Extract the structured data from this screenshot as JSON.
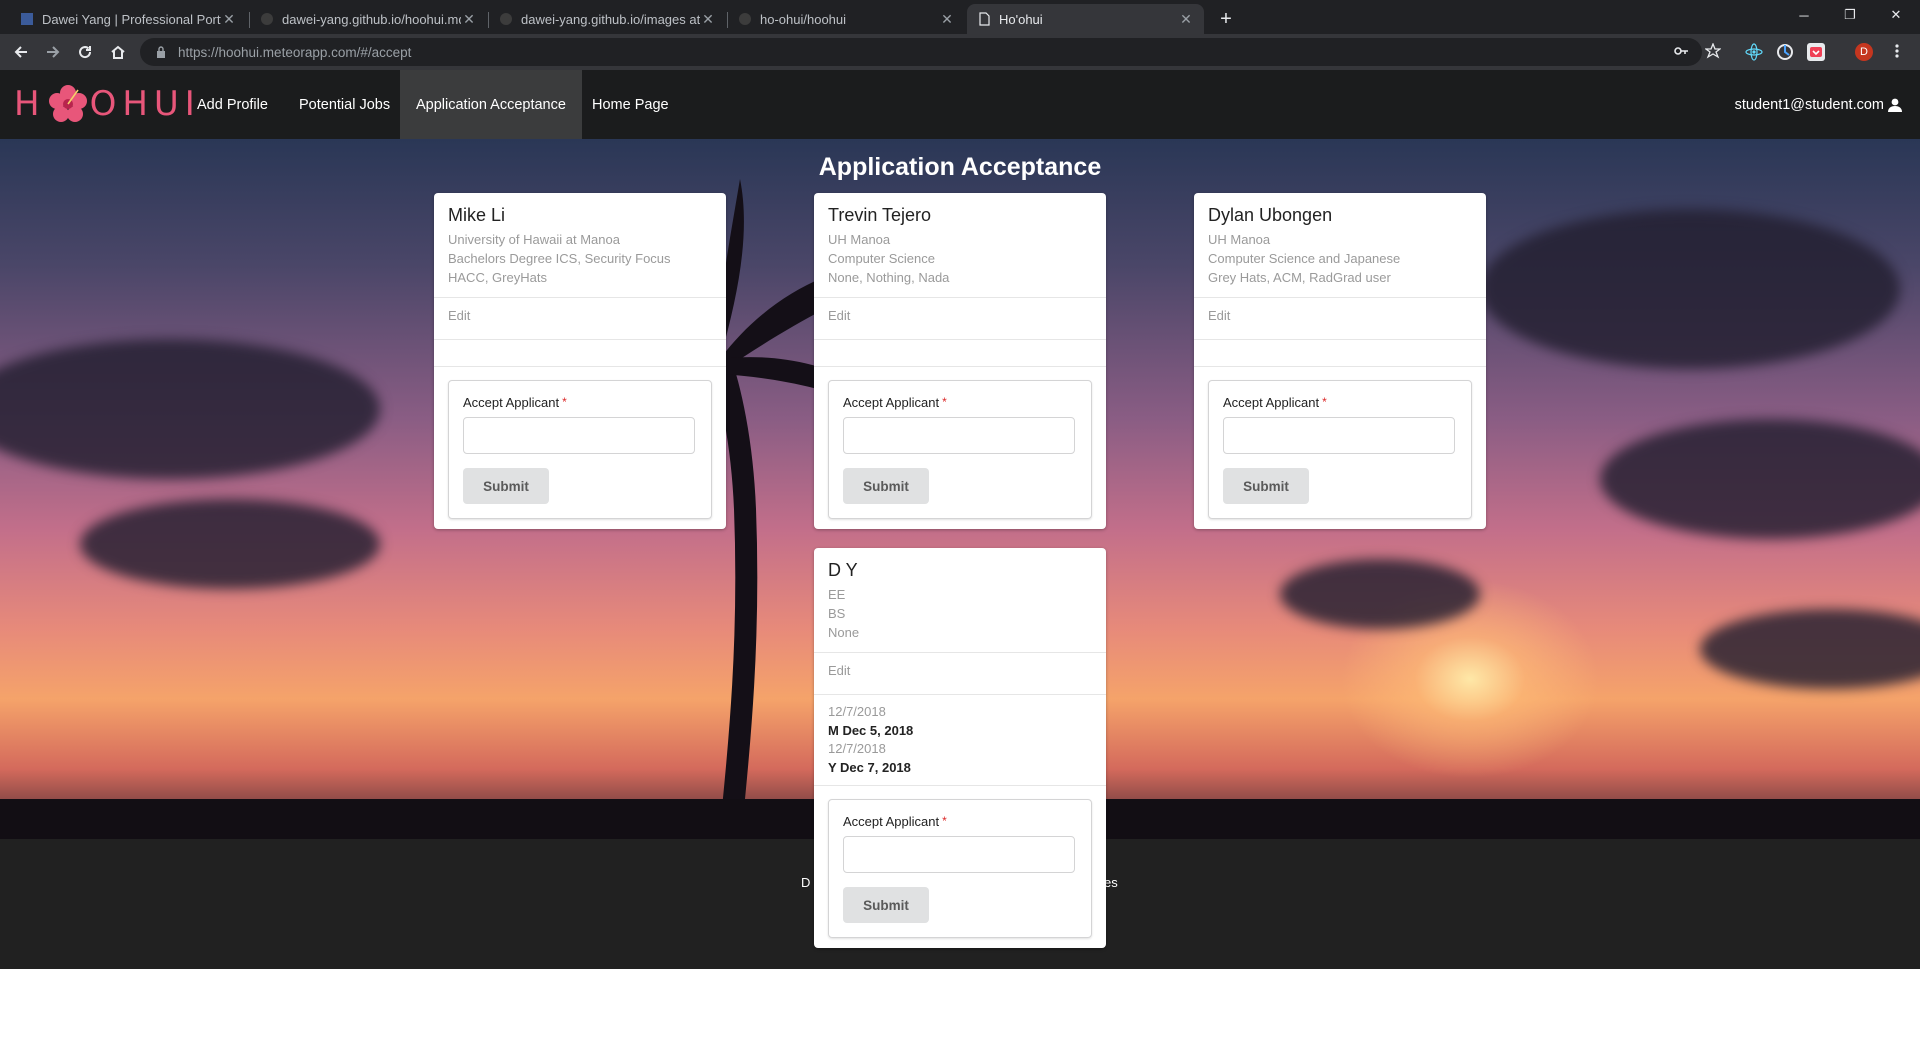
{
  "browser": {
    "tabs": [
      {
        "title": "Dawei Yang | Professional Portfol",
        "active": false,
        "icon": "portfolio-favicon"
      },
      {
        "title": "dawei-yang.github.io/hoohui.md",
        "active": false,
        "icon": "github-favicon"
      },
      {
        "title": "dawei-yang.github.io/images at",
        "active": false,
        "icon": "github-favicon"
      },
      {
        "title": "ho-ohui/hoohui",
        "active": false,
        "icon": "github-favicon"
      },
      {
        "title": "Ho'ohui",
        "active": true,
        "icon": "page-favicon"
      }
    ],
    "url": "https://hoohui.meteorapp.com/#/accept",
    "profile_initial": "D"
  },
  "navbar": {
    "logo_left": "H",
    "logo_right": "OHUI",
    "items": [
      {
        "label": "Add Profile",
        "active": false
      },
      {
        "label": "Potential Jobs",
        "active": false
      },
      {
        "label": "Application Acceptance",
        "active": true
      },
      {
        "label": "Home Page",
        "active": false
      }
    ],
    "user": "student1@student.com"
  },
  "page": {
    "title": "Application Acceptance"
  },
  "cards": [
    {
      "name": "Mike Li",
      "meta": [
        "University of Hawaii at Manoa",
        "Bachelors Degree ICS, Security Focus",
        "HACC, GreyHats"
      ],
      "edit": "Edit",
      "form": {
        "label": "Accept Applicant",
        "required_mark": "*",
        "value": "",
        "submit": "Submit"
      }
    },
    {
      "name": "Trevin Tejero",
      "meta": [
        "UH Manoa",
        "Computer Science",
        "None, Nothing, Nada"
      ],
      "edit": "Edit",
      "form": {
        "label": "Accept Applicant",
        "required_mark": "*",
        "value": "",
        "submit": "Submit"
      }
    },
    {
      "name": "Dylan Ubongen",
      "meta": [
        "UH Manoa",
        "Computer Science and Japanese",
        "Grey Hats, ACM, RadGrad user"
      ],
      "edit": "Edit",
      "form": {
        "label": "Accept Applicant",
        "required_mark": "*",
        "value": "",
        "submit": "Submit"
      }
    },
    {
      "name": "D Y",
      "meta": [
        "EE",
        "BS",
        "None"
      ],
      "edit": "Edit",
      "notes": [
        {
          "date": "12/7/2018",
          "text": "M Dec 5, 2018"
        },
        {
          "date": "12/7/2018",
          "text": "Y Dec 7, 2018"
        }
      ],
      "form": {
        "label": "Accept Applicant",
        "required_mark": "*",
        "value": "",
        "submit": "Submit"
      }
    }
  ],
  "footer": {
    "left_fragment": "D",
    "right_fragment": "es"
  },
  "colors": {
    "navbar_bg": "#1b1c1d",
    "logo": "#e8567a",
    "required": "#db2828",
    "footer_bg": "#212121"
  }
}
